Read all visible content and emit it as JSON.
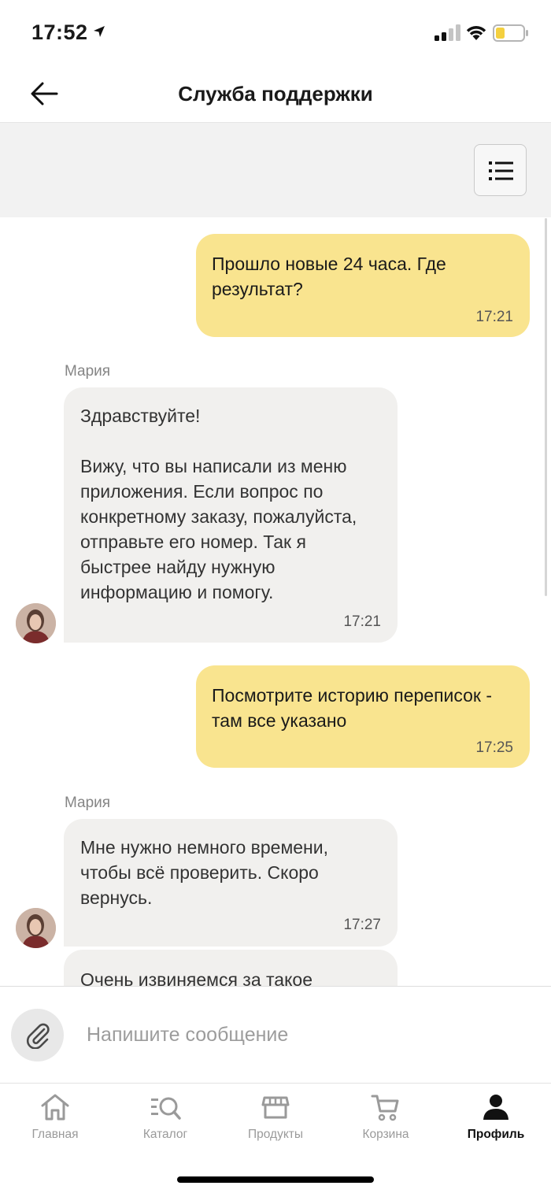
{
  "status_bar": {
    "time": "17:52",
    "battery_color": "#f4d03f"
  },
  "header": {
    "title": "Служба поддержки"
  },
  "chat": {
    "messages": [
      {
        "direction": "outgoing",
        "text": "Прошло новые 24 часа. Где результат?",
        "time": "17:21"
      },
      {
        "direction": "incoming",
        "sender": "Мария",
        "text": "Здравствуйте!\n\nВижу, что вы написали из меню приложения. Если вопрос по конкретному заказу, пожалуйста, отправьте его номер. Так я быстрее найду нужную информацию и помогу.",
        "time": "17:21"
      },
      {
        "direction": "outgoing",
        "text": "Посмотрите историю переписок - там все указано",
        "time": "17:25"
      },
      {
        "direction": "incoming",
        "sender": "Мария",
        "text": "Мне нужно немного времени, чтобы всё проверить. Скоро вернусь.",
        "time": "17:27"
      },
      {
        "direction": "incoming",
        "text": "Очень извиняемся за такое"
      }
    ]
  },
  "composer": {
    "placeholder": "Напишите сообщение"
  },
  "tabbar": {
    "tabs": [
      {
        "label": "Главная",
        "icon": "home-icon"
      },
      {
        "label": "Каталог",
        "icon": "catalog-search-icon"
      },
      {
        "label": "Продукты",
        "icon": "store-icon"
      },
      {
        "label": "Корзина",
        "icon": "cart-icon"
      },
      {
        "label": "Профиль",
        "icon": "profile-icon",
        "active": true
      }
    ]
  },
  "colors": {
    "outgoing_bubble": "#f9e48f",
    "incoming_bubble": "#f1f0ee",
    "toolbar_background": "#f2f2f2"
  }
}
